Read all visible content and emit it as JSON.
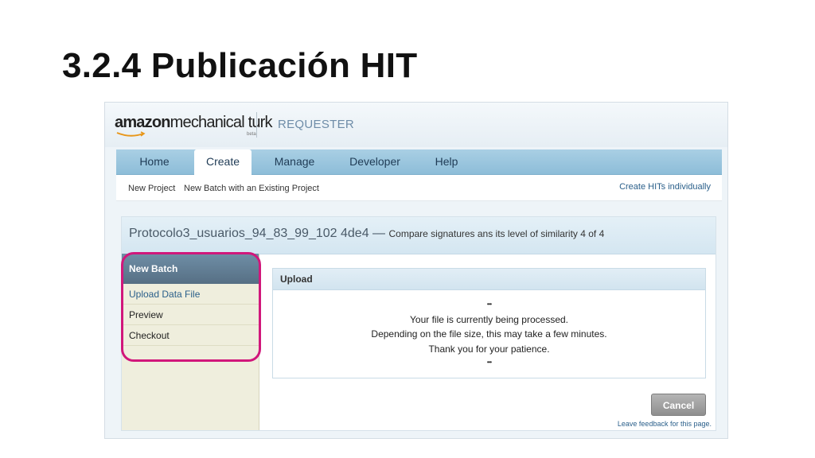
{
  "slide": {
    "title": "3.2.4 Publicación HIT"
  },
  "brand": {
    "logo_amazon": "amazon",
    "logo_mturk": "mechanical turk",
    "logo_beta": "beta",
    "section": "REQUESTER"
  },
  "nav": {
    "tabs": [
      {
        "label": "Home",
        "active": false
      },
      {
        "label": "Create",
        "active": true
      },
      {
        "label": "Manage",
        "active": false
      },
      {
        "label": "Developer",
        "active": false
      },
      {
        "label": "Help",
        "active": false
      }
    ]
  },
  "subnav": {
    "links": [
      "New Project",
      "New Batch with an Existing Project"
    ],
    "right_link": "Create HITs individually"
  },
  "project": {
    "name": "Protocolo3_usuarios_94_83_99_102 4de4",
    "separator": " — ",
    "description": "Compare signatures ans its level of similarity 4 of 4"
  },
  "sidebar": {
    "header": "New Batch",
    "items": [
      {
        "label": "Upload Data File",
        "type": "link"
      },
      {
        "label": "Preview",
        "type": "plain"
      },
      {
        "label": "Checkout",
        "type": "plain"
      }
    ]
  },
  "upload": {
    "title": "Upload",
    "dots": "•••",
    "lines": [
      "Your file is currently being processed.",
      "Depending on the file size, this may take a few minutes.",
      "Thank you for your patience."
    ]
  },
  "actions": {
    "cancel_label": "Cancel",
    "feedback_link": "Leave feedback for this page."
  },
  "colors": {
    "highlight": "#d1177b",
    "nav_bar": "#9fc8df",
    "sidebar_header": "#5f7a90",
    "link": "#2a5f8a"
  }
}
